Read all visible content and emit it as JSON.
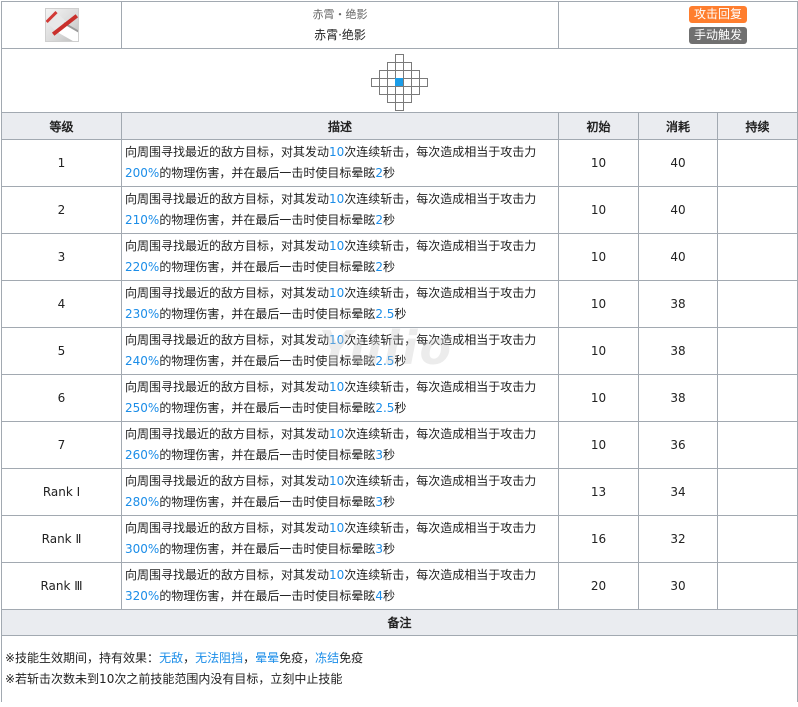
{
  "skill": {
    "name_sub": "赤霄・绝影",
    "name_main": "赤霄·绝影",
    "tags": [
      {
        "label": "攻击回复",
        "color": "#ff7e2e"
      },
      {
        "label": "手动触发",
        "color": "#707070"
      }
    ],
    "icon": "sword-slash-icon"
  },
  "columns": {
    "level": "等级",
    "desc": "描述",
    "initial": "初始",
    "cost": "消耗",
    "duration": "持续"
  },
  "desc_parts": {
    "p1": "向周围寻找最近的敌方目标，对其发动",
    "p2": "次连续斩击，每次造成相当于攻击力",
    "p3": "的物理伤害，并在最后一击时使目标晕眩",
    "p4": "秒"
  },
  "rows": [
    {
      "level": "1",
      "hits": "10",
      "pct": "200%",
      "stun": "2",
      "initial": "10",
      "cost": "40",
      "duration": ""
    },
    {
      "level": "2",
      "hits": "10",
      "pct": "210%",
      "stun": "2",
      "initial": "10",
      "cost": "40",
      "duration": ""
    },
    {
      "level": "3",
      "hits": "10",
      "pct": "220%",
      "stun": "2",
      "initial": "10",
      "cost": "40",
      "duration": ""
    },
    {
      "level": "4",
      "hits": "10",
      "pct": "230%",
      "stun": "2.5",
      "initial": "10",
      "cost": "38",
      "duration": ""
    },
    {
      "level": "5",
      "hits": "10",
      "pct": "240%",
      "stun": "2.5",
      "initial": "10",
      "cost": "38",
      "duration": ""
    },
    {
      "level": "6",
      "hits": "10",
      "pct": "250%",
      "stun": "2.5",
      "initial": "10",
      "cost": "38",
      "duration": ""
    },
    {
      "level": "7",
      "hits": "10",
      "pct": "260%",
      "stun": "3",
      "initial": "10",
      "cost": "36",
      "duration": ""
    },
    {
      "level": "Rank Ⅰ",
      "hits": "10",
      "pct": "280%",
      "stun": "3",
      "initial": "13",
      "cost": "34",
      "duration": ""
    },
    {
      "level": "Rank Ⅱ",
      "hits": "10",
      "pct": "300%",
      "stun": "3",
      "initial": "16",
      "cost": "32",
      "duration": ""
    },
    {
      "level": "Rank Ⅲ",
      "hits": "10",
      "pct": "320%",
      "stun": "4",
      "initial": "20",
      "cost": "30",
      "duration": ""
    }
  ],
  "notes": {
    "header": "备注",
    "line1_prefix": "※技能生效期间，持有效果：",
    "line1_links": [
      "无敌",
      "无法阻挡",
      "晕晕"
    ],
    "line1_link1": "无敌",
    "line1_sep1": "，",
    "line1_link2": "无法阻挡",
    "line1_sep2": "，",
    "line1_link3": "晕晕",
    "line1_text3": "免疫，",
    "line1_link4": "冻结",
    "line1_text4": "免疫",
    "line2": "※若斩击次数未到10次之前技能范围内没有目标，立刻中止技能"
  },
  "watermark": "Yulio"
}
